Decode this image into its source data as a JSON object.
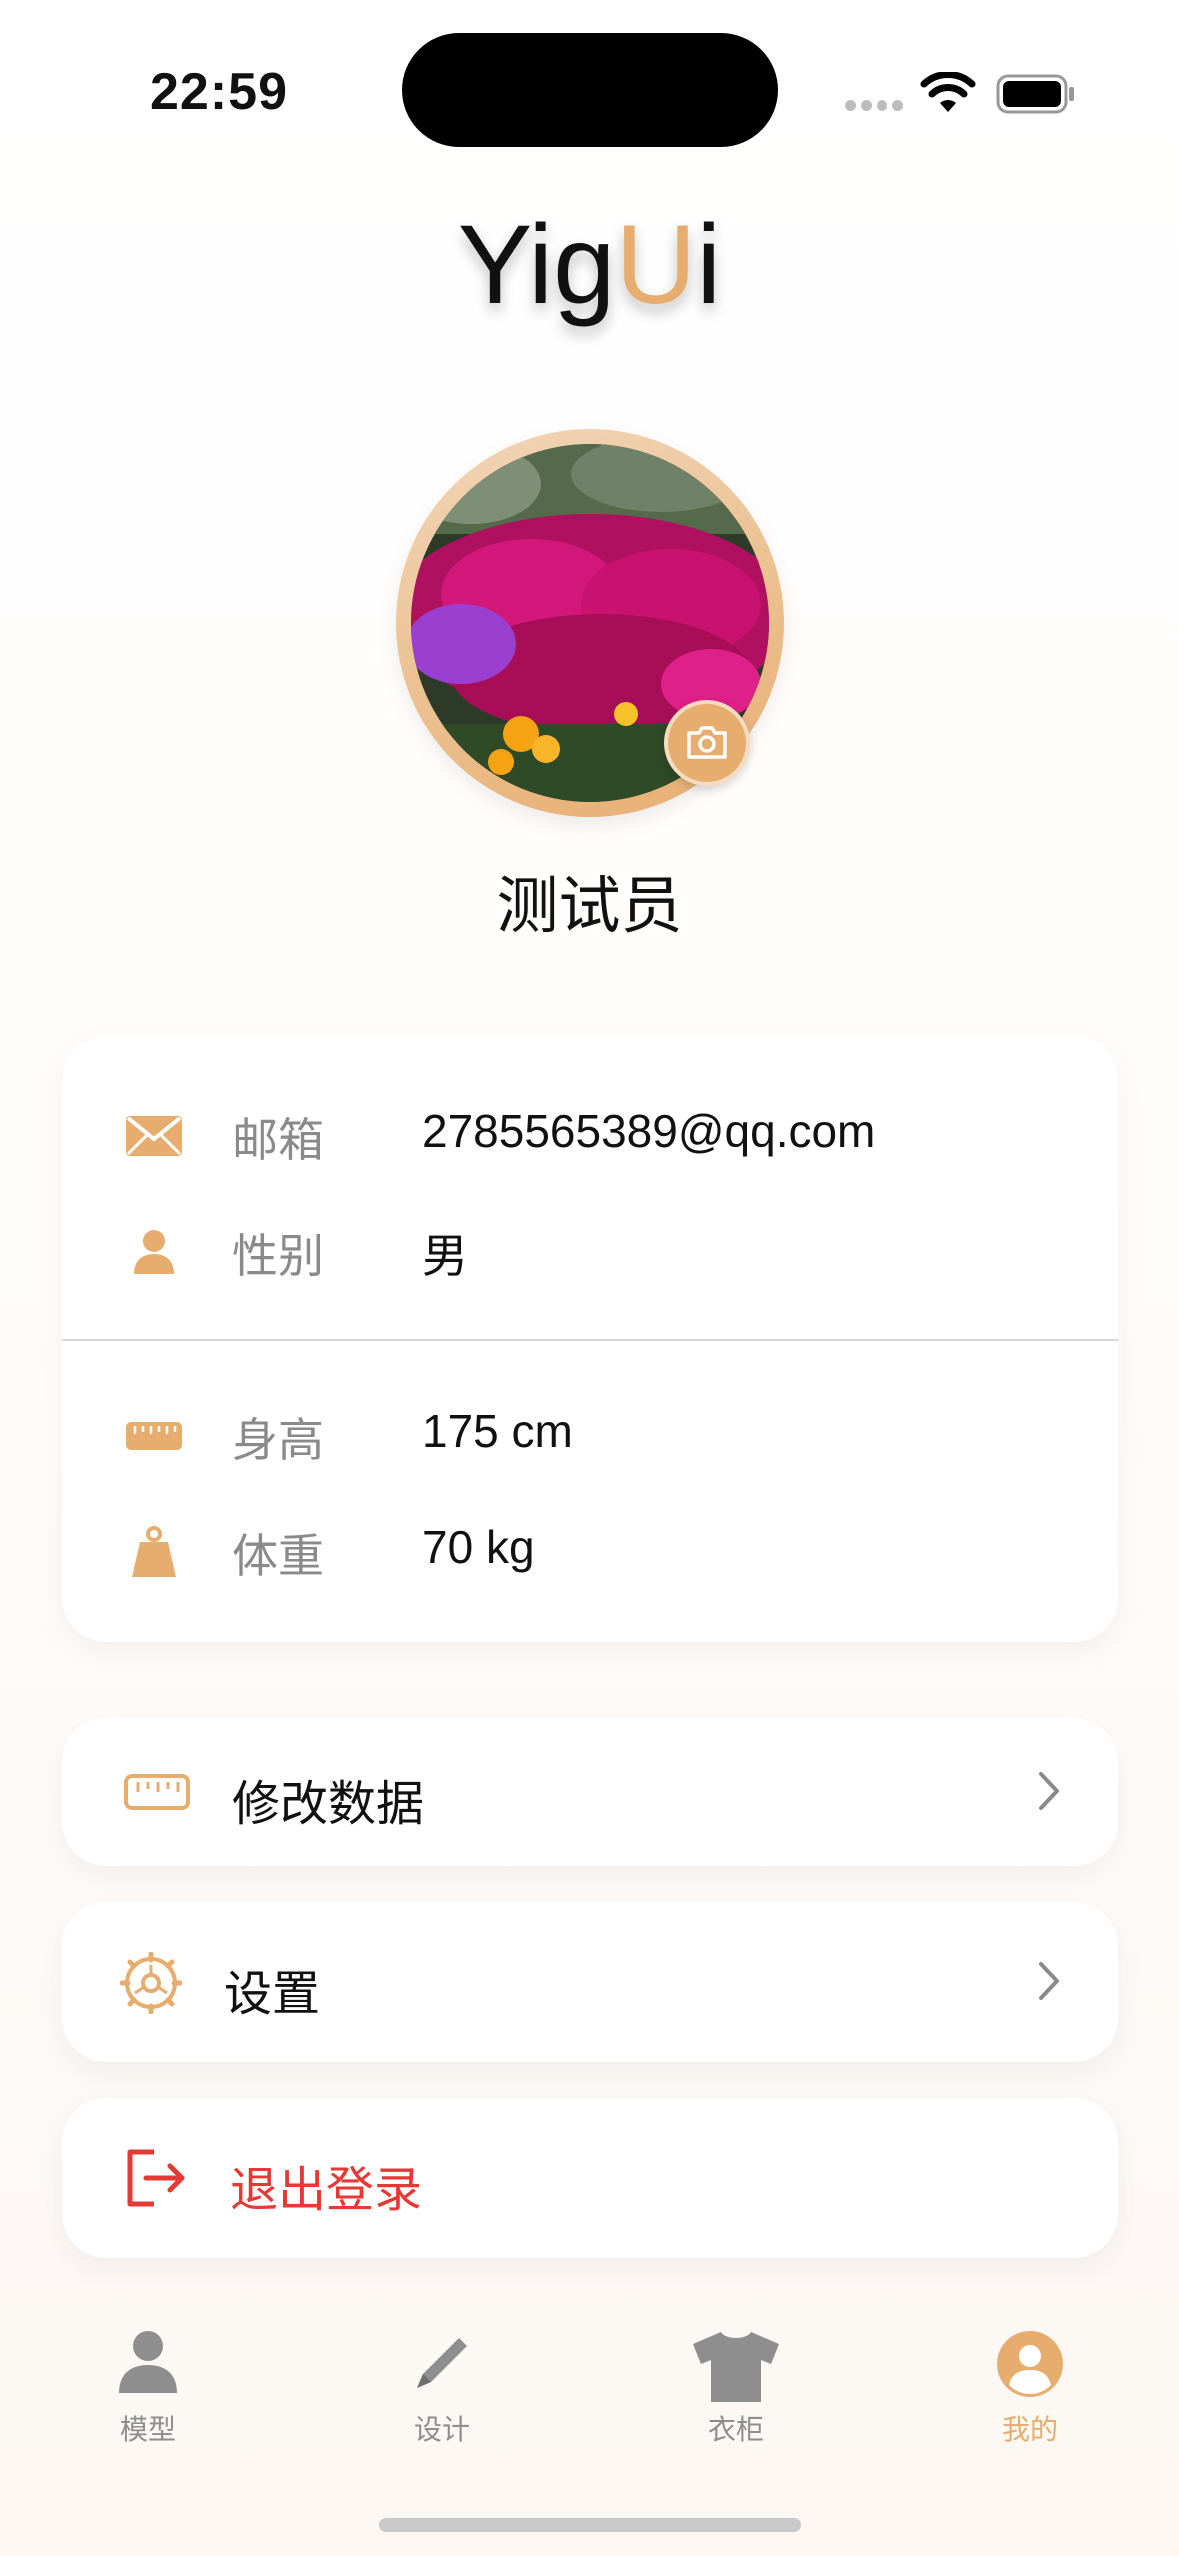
{
  "status_bar": {
    "time": "22:59"
  },
  "app": {
    "logo_part1": "Yig",
    "logo_accent": "U",
    "logo_part2": "i",
    "accent_color": "#e6ad6f"
  },
  "profile": {
    "username": "测试员"
  },
  "info": {
    "email_label": "邮箱",
    "email_value": "2785565389@qq.com",
    "gender_label": "性别",
    "gender_value": "男",
    "height_label": "身高",
    "height_value": "175 cm",
    "weight_label": "体重",
    "weight_value": "70 kg"
  },
  "menu": {
    "edit_data": "修改数据",
    "settings": "设置",
    "logout": "退出登录",
    "logout_color": "#e53935"
  },
  "tabbar": {
    "model": "模型",
    "design": "设计",
    "wardrobe": "衣柜",
    "mine": "我的"
  },
  "icons": [
    "mail-icon",
    "person-icon",
    "ruler-icon",
    "weight-icon",
    "gear-icon",
    "logout-icon",
    "chevron-right-icon",
    "camera-icon",
    "wifi-icon",
    "battery-icon"
  ]
}
